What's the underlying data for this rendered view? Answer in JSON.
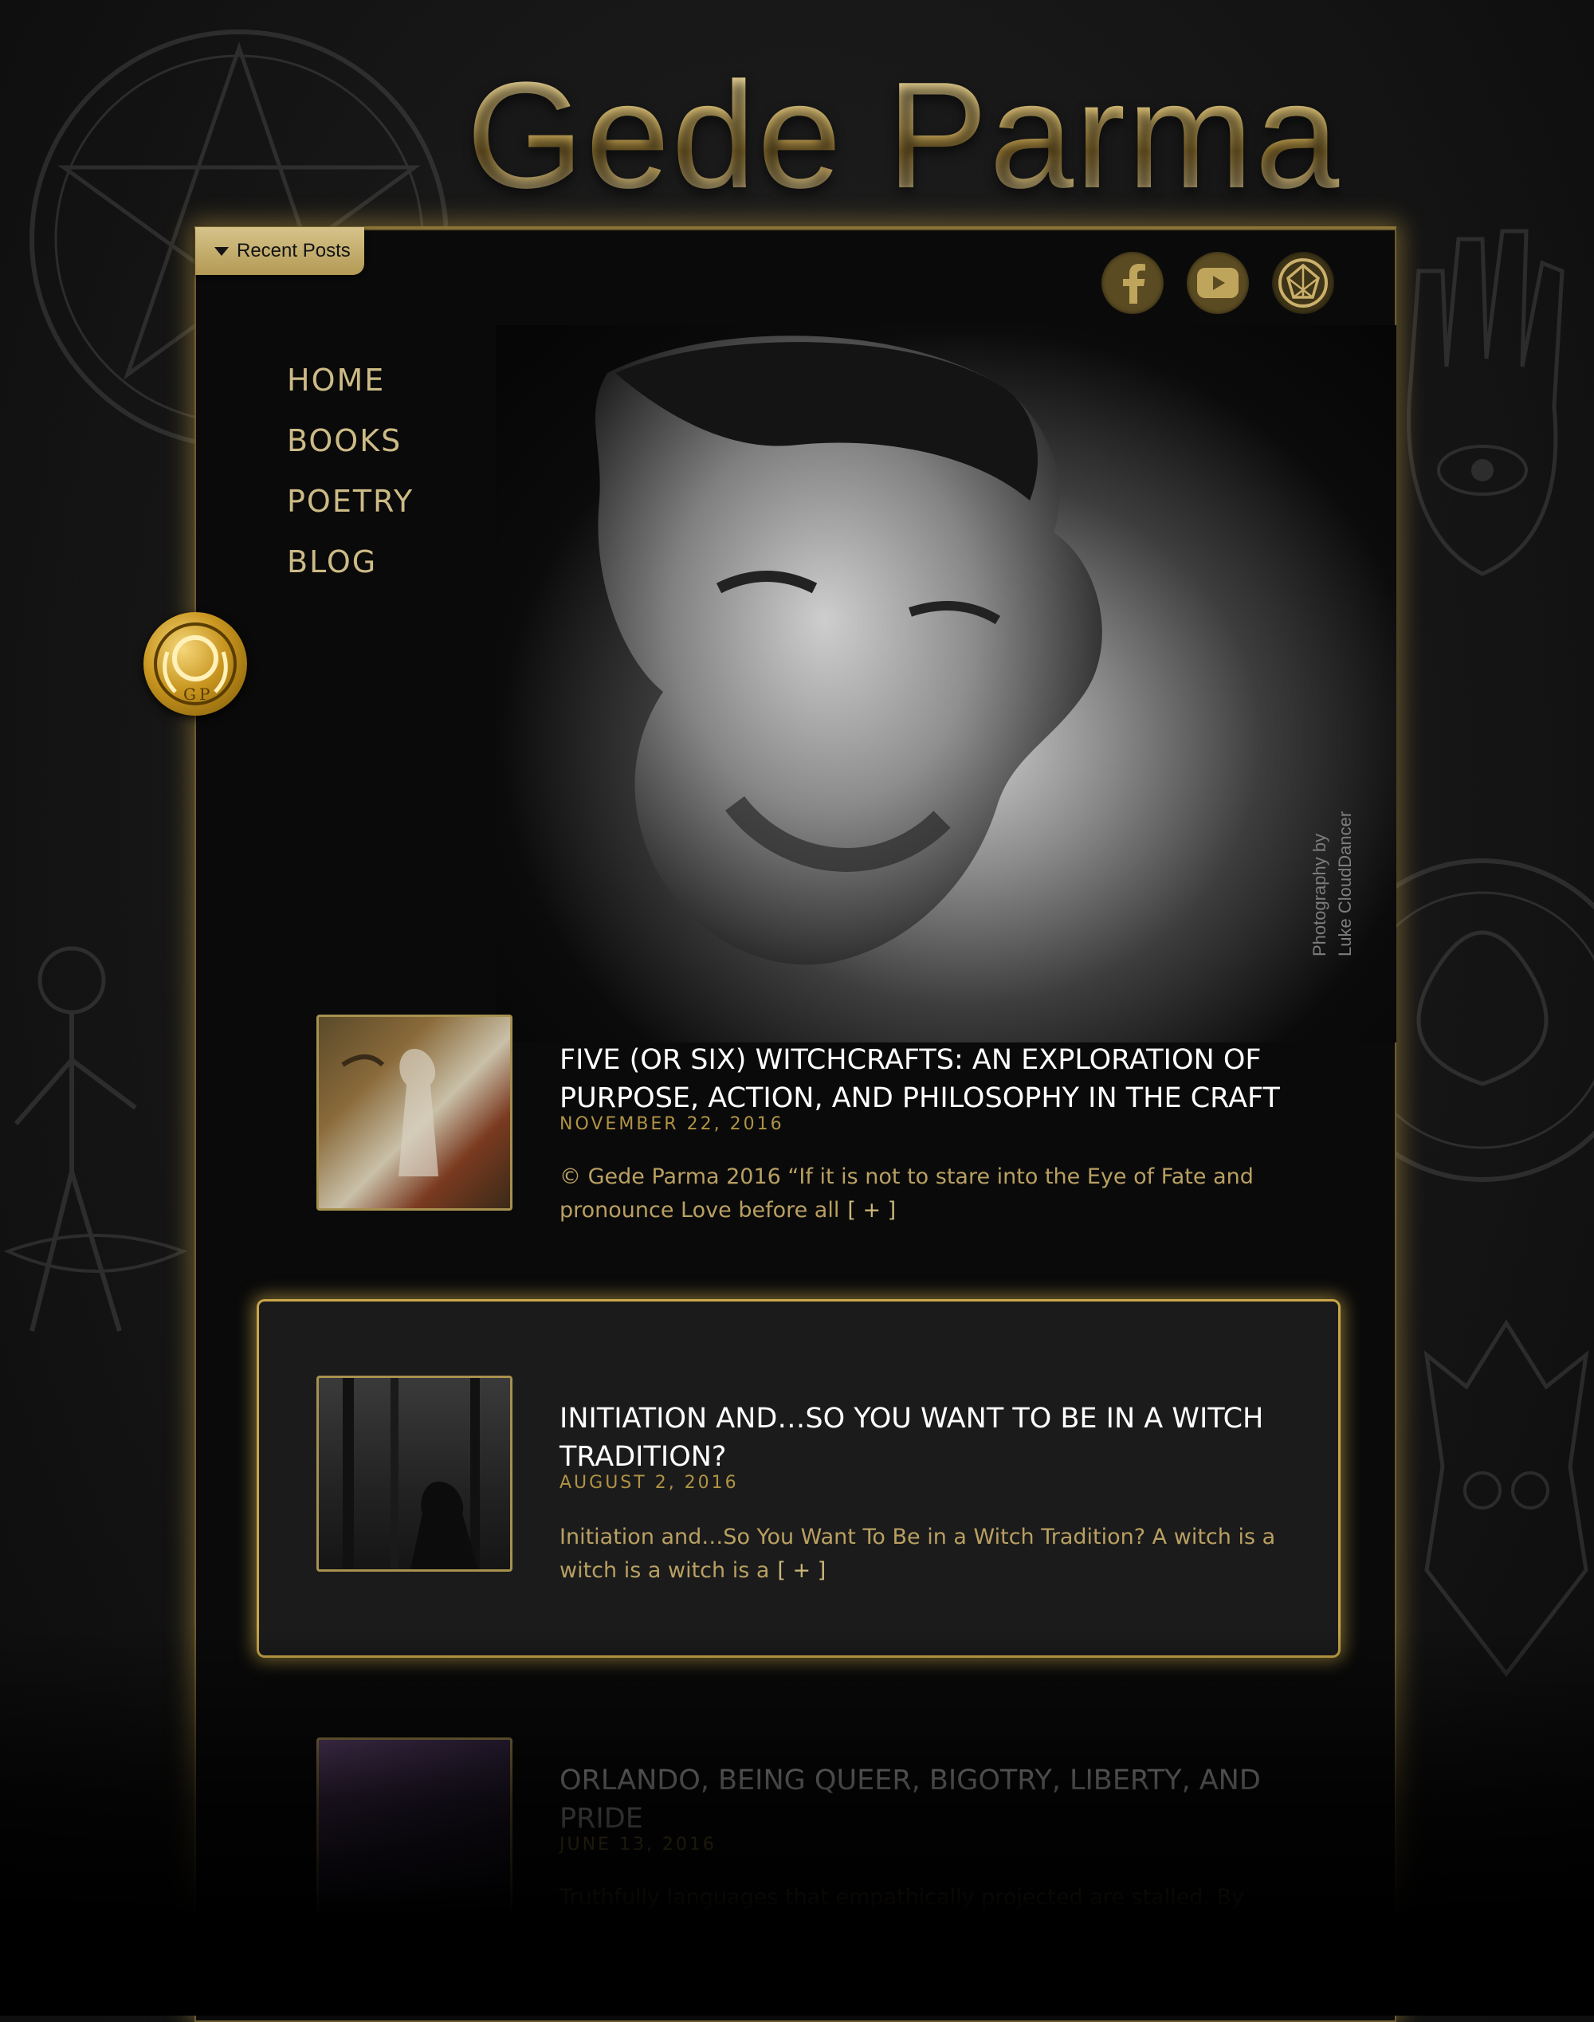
{
  "site": {
    "title": "Gede Parma"
  },
  "recent_posts_tab": {
    "label": "Recent Posts"
  },
  "social": [
    {
      "name": "facebook-icon"
    },
    {
      "name": "youtube-icon"
    },
    {
      "name": "emblem-icon"
    }
  ],
  "nav": {
    "items": [
      "HOME",
      "BOOKS",
      "POETRY",
      "BLOG"
    ]
  },
  "hero": {
    "credit_line1": "Photography by",
    "credit_line2": "Luke CloudDancer"
  },
  "posts": [
    {
      "title": "FIVE (OR SIX) WITCHCRAFTS: AN EXPLORATION OF PURPOSE, ACTION, AND PHILOSOPHY IN THE CRAFT",
      "date": "NOVEMBER 22, 2016",
      "excerpt": "© Gede Parma 2016 “If it is not to stare into the Eye of Fate and pronounce Love before all",
      "more": "[ + ]"
    },
    {
      "title": "INITIATION AND…SO YOU WANT TO BE IN A WITCH TRADITION?",
      "date": "AUGUST 2, 2016",
      "excerpt": "Initiation and…So You Want To Be in a Witch Tradition? A witch is a witch is a witch is a",
      "more": "[ + ]"
    },
    {
      "title": "ORLANDO, BEING QUEER, BIGOTRY, LIBERTY, AND PRIDE",
      "date": "JUNE 13, 2016",
      "excerpt": "Truthfully languages that empathically projected are stalled. By those",
      "more": ""
    }
  ],
  "colors": {
    "gold": "#c9a647",
    "gold_text": "#cdbb86",
    "panel_bg": "#0a0a0a"
  }
}
